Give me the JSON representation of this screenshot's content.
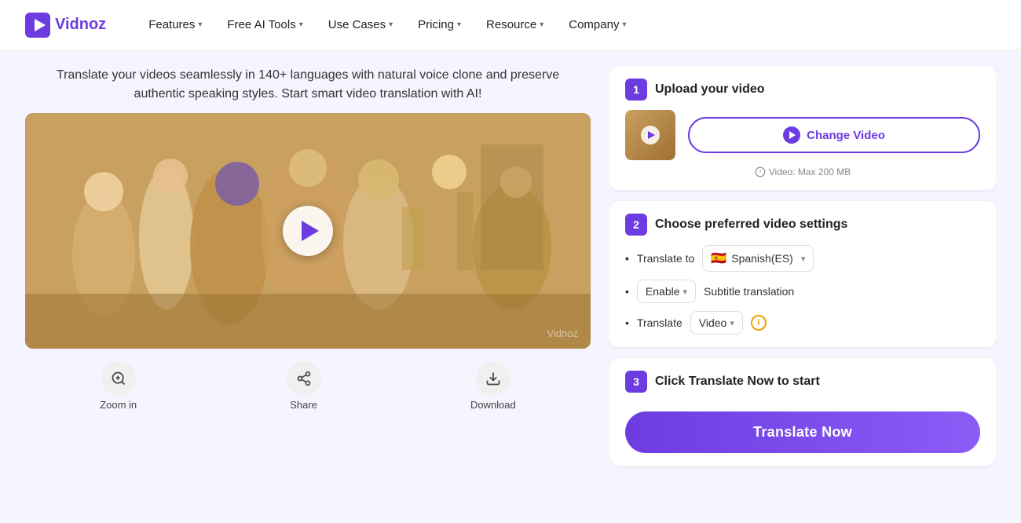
{
  "brand": {
    "name": "Vidnoz",
    "logo_alt": "Vidnoz logo"
  },
  "nav": {
    "items": [
      {
        "label": "Features",
        "has_dropdown": true
      },
      {
        "label": "Free AI Tools",
        "has_dropdown": true
      },
      {
        "label": "Use Cases",
        "has_dropdown": true
      },
      {
        "label": "Pricing",
        "has_dropdown": true
      },
      {
        "label": "Resource",
        "has_dropdown": true
      },
      {
        "label": "Company",
        "has_dropdown": true
      }
    ]
  },
  "hero": {
    "subtitle": "Translate your videos seamlessly in 140+ languages with natural voice clone and preserve authentic speaking styles. Start smart video translation with AI!"
  },
  "video": {
    "watermark": "Vidnoz",
    "controls": {
      "zoom_label": "Zoom in",
      "share_label": "Share",
      "download_label": "Download"
    }
  },
  "steps": {
    "step1": {
      "badge": "1",
      "title": "Upload your video",
      "change_video_label": "Change Video",
      "file_limit": "Video: Max 200 MB"
    },
    "step2": {
      "badge": "2",
      "title": "Choose preferred video settings",
      "translate_to_label": "Translate to",
      "language_flag": "🇪🇸",
      "language_name": "Spanish(ES)",
      "enable_label": "Enable",
      "subtitle_label": "Subtitle translation",
      "translate_label": "Translate",
      "video_type_label": "Video"
    },
    "step3": {
      "badge": "3",
      "title": "Click Translate Now to start",
      "cta_label": "Translate Now"
    }
  }
}
